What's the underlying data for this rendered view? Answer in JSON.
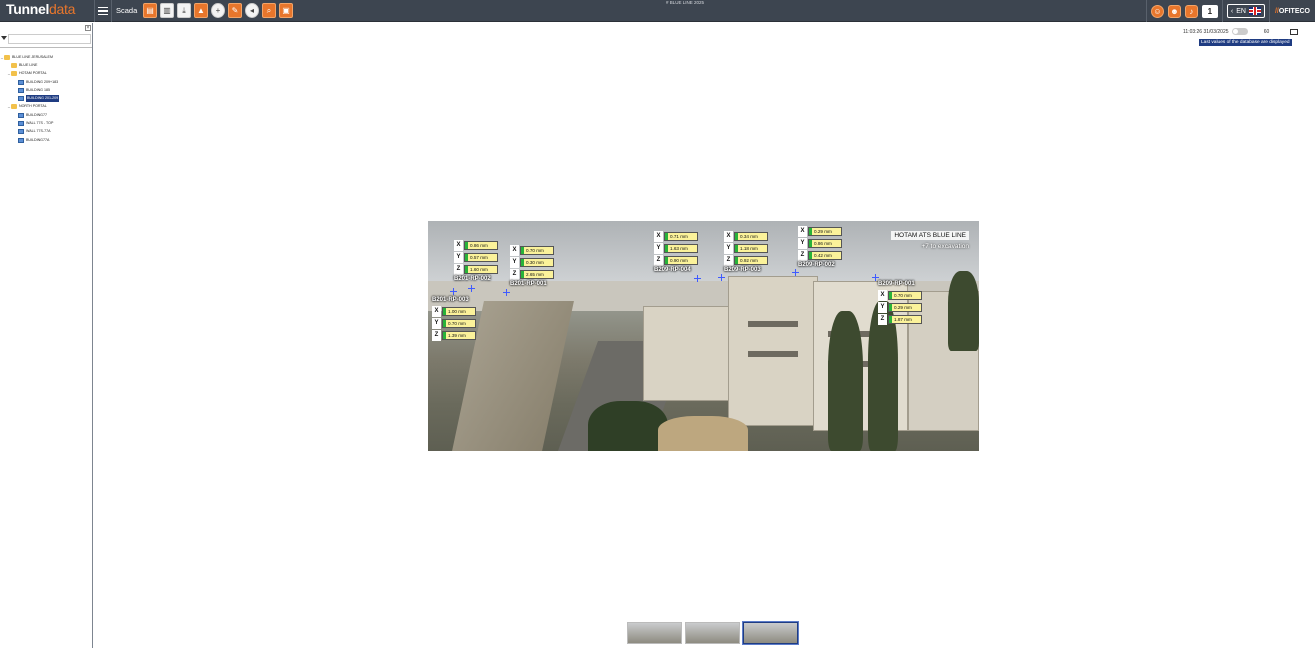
{
  "header": {
    "logo_part1": "Tunnel",
    "logo_part2": "data",
    "section": "Scada",
    "center_title": "# BLUE LINE 2025",
    "notification_count": "1",
    "language": "EN",
    "brand_prefix": "//",
    "brand": "OFITECO",
    "tool_icons": [
      "document-icon",
      "clipboard-icon",
      "download-icon",
      "image-upload-icon",
      "add-icon",
      "edit-icon",
      "back-icon",
      "zoom-icon",
      "save-icon"
    ]
  },
  "sidebar": {
    "filter_placeholder": "",
    "tree": [
      {
        "label": "BLUE LINE JERUSALEM",
        "level": 0,
        "type": "folder",
        "toggle": "–"
      },
      {
        "label": "BLUE LINE",
        "level": 1,
        "type": "folder",
        "toggle": ""
      },
      {
        "label": "HOTAM PORTAL",
        "level": 1,
        "type": "folder",
        "toggle": "–"
      },
      {
        "label": "BUILDING 209+183",
        "level": 2,
        "type": "building",
        "toggle": ""
      },
      {
        "label": "BUILDING 185",
        "level": 2,
        "type": "building",
        "toggle": ""
      },
      {
        "label": "BUILDING 201-209",
        "level": 2,
        "type": "building",
        "toggle": "",
        "selected": true
      },
      {
        "label": "NORTH PORTAL",
        "level": 1,
        "type": "folder",
        "toggle": "–"
      },
      {
        "label": "BUILDING77",
        "level": 2,
        "type": "building",
        "toggle": ""
      },
      {
        "label": "WALL 77S - TOP",
        "level": 2,
        "type": "building",
        "toggle": ""
      },
      {
        "label": "WALL 77S-77A",
        "level": 2,
        "type": "building",
        "toggle": ""
      },
      {
        "label": "BUILDING77A",
        "level": 2,
        "type": "building",
        "toggle": ""
      }
    ]
  },
  "status": {
    "timestamp": "11:03:26 31/03/2025",
    "refresh_seconds": "60",
    "notice": "Last values of the database are displayed"
  },
  "photo": {
    "title": "HOTAM ATS BLUE LINE",
    "subtitle": "+7 to excavation",
    "sensors": [
      {
        "name": "B201-RP-002",
        "x": "0.86 mm",
        "y": "0.57 mm",
        "z": "1.60 mm"
      },
      {
        "name": "B201-RP-001",
        "x": "0.70 mm",
        "y": "0.30 mm",
        "z": "2.65 mm"
      },
      {
        "name": "B201-RP-003",
        "x": "1.00 mm",
        "y": "0.70 mm",
        "z": "1.39 mm"
      },
      {
        "name": "B209-RP-004",
        "x": "0.71 mm",
        "y": "1.63 mm",
        "z": "0.90 mm"
      },
      {
        "name": "B209-RP-003",
        "x": "0.34 mm",
        "y": "1.18 mm",
        "z": "0.92 mm"
      },
      {
        "name": "B209-RP-002",
        "x": "0.29 mm",
        "y": "0.86 mm",
        "z": "0.42 mm"
      },
      {
        "name": "B209-RP-001",
        "x": "0.70 mm",
        "y": "0.29 mm",
        "z": "1.87 mm"
      }
    ]
  },
  "colors": {
    "topbar": "#3d4550",
    "accent": "#e8762c",
    "selection": "#1f3c82",
    "sensor_value_bg": "#fbf29a",
    "sensor_ok": "#28b23a"
  }
}
